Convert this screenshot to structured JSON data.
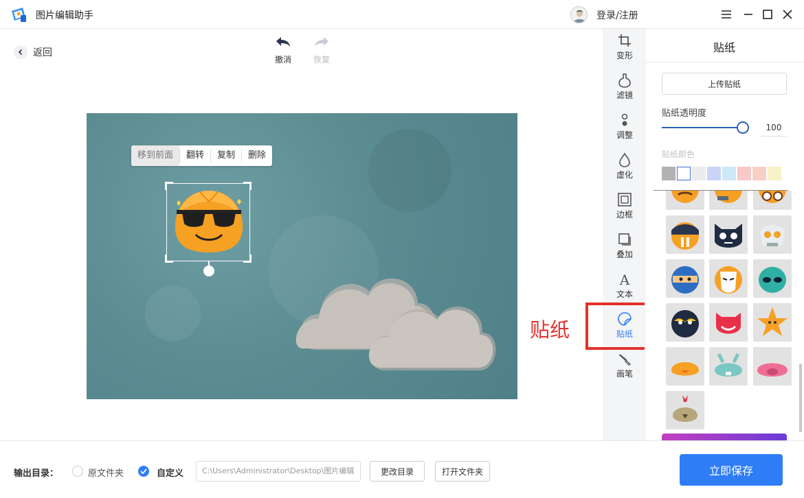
{
  "app": {
    "title": "图片编辑助手",
    "login_label": "登录/注册",
    "window_controls": [
      "menu-icon",
      "minimize-icon",
      "maximize-icon",
      "close-icon"
    ]
  },
  "toolbar": {
    "back_label": "返回",
    "undo_label": "撤消",
    "redo_label": "恢复"
  },
  "context_menu": {
    "items": [
      "移到前面",
      "翻转",
      "复制",
      "删除"
    ]
  },
  "tools": [
    {
      "label": "变形",
      "icon": "crop-icon"
    },
    {
      "label": "滤镜",
      "icon": "filter-icon"
    },
    {
      "label": "调整",
      "icon": "adjust-icon"
    },
    {
      "label": "虚化",
      "icon": "blur-icon"
    },
    {
      "label": "边框",
      "icon": "border-icon"
    },
    {
      "label": "叠加",
      "icon": "overlay-icon"
    },
    {
      "label": "文本",
      "icon": "text-icon"
    },
    {
      "label": "贴纸",
      "icon": "sticker-icon",
      "active": true
    },
    {
      "label": "画笔",
      "icon": "brush-icon"
    }
  ],
  "annotation": {
    "label": "贴纸",
    "color": "#e5302c"
  },
  "sticker_panel": {
    "title": "贴纸",
    "upload_label": "上传贴纸",
    "opacity_label": "贴纸透明度",
    "opacity_value": "100",
    "opacity_fraction": 1.0,
    "color_label": "贴纸颜色",
    "colors": [
      "#b3b3b3",
      "#ffffff",
      "#ececec",
      "#c9d4f7",
      "#cde9f8",
      "#f7c9c9",
      "#f7cfc5",
      "#f7f2c9"
    ],
    "stickers": [
      "mustache-face",
      "gun-face",
      "glasses-face",
      "walrus",
      "black-cat",
      "skull",
      "ninja",
      "mask-face",
      "alien",
      "wrestler-mask",
      "red-devil",
      "star",
      "orange-chick",
      "bunny",
      "pig",
      "chicken"
    ]
  },
  "footer": {
    "output_label": "输出目录：",
    "option_original": "原文件夹",
    "option_custom": "自定义",
    "path_value": "C:\\Users\\Administrator\\Desktop\\图片编辑",
    "change_dir_label": "更改目录",
    "open_folder_label": "打开文件夹",
    "save_label": "立即保存"
  },
  "colors": {
    "accent": "#2f7df6",
    "canvas_bg": "#5b8c92"
  }
}
